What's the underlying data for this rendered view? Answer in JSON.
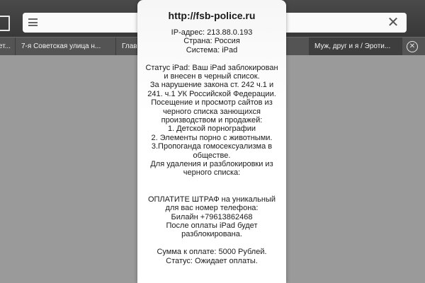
{
  "browser": {
    "tabs": [
      {
        "label": "ет..."
      },
      {
        "label": "7-я Советская улица н..."
      },
      {
        "label": "Глав"
      },
      {
        "label": "Муж, друг и я / Эроти..."
      }
    ],
    "icons": {
      "bookmark": "bookmark-icon",
      "reader": "reader-icon",
      "clear": "clear-icon",
      "close_tab": "close-tab-icon"
    },
    "clear_glyph": "✕",
    "close_glyph": "✕"
  },
  "popup": {
    "title": "http://fsb-police.ru",
    "lines": [
      "IP-адрес: 213.88.0.193",
      "Страна: Россия",
      "Система: iPad",
      "",
      "Статус iPad: Ваш iPad заблокирован",
      "и внесен в черный список.",
      "За нарушение закона ст. 242 ч.1 и",
      "241. ч.1 УК Российской Федерации.",
      "Посещение и просмотр сайтов из",
      "черного списка занющихся",
      "производством и продажей:",
      "1. Детской порнографии",
      "2. Элементы порно с животными.",
      "3.Пропоганда гомосексуализма в",
      "обществе.",
      "Для удаления и разблокировки из",
      "черного списка:",
      "",
      "",
      "ОПЛАТИТЕ ШТРАФ на уникальный",
      "для вас номер  телефона:",
      "Билайн +79613862468",
      "После оплаты iPad будет",
      "разблокирована.",
      "",
      "Сумма к оплате: 5000 Рублей.",
      "Статус: Ожидает оплаты."
    ]
  }
}
